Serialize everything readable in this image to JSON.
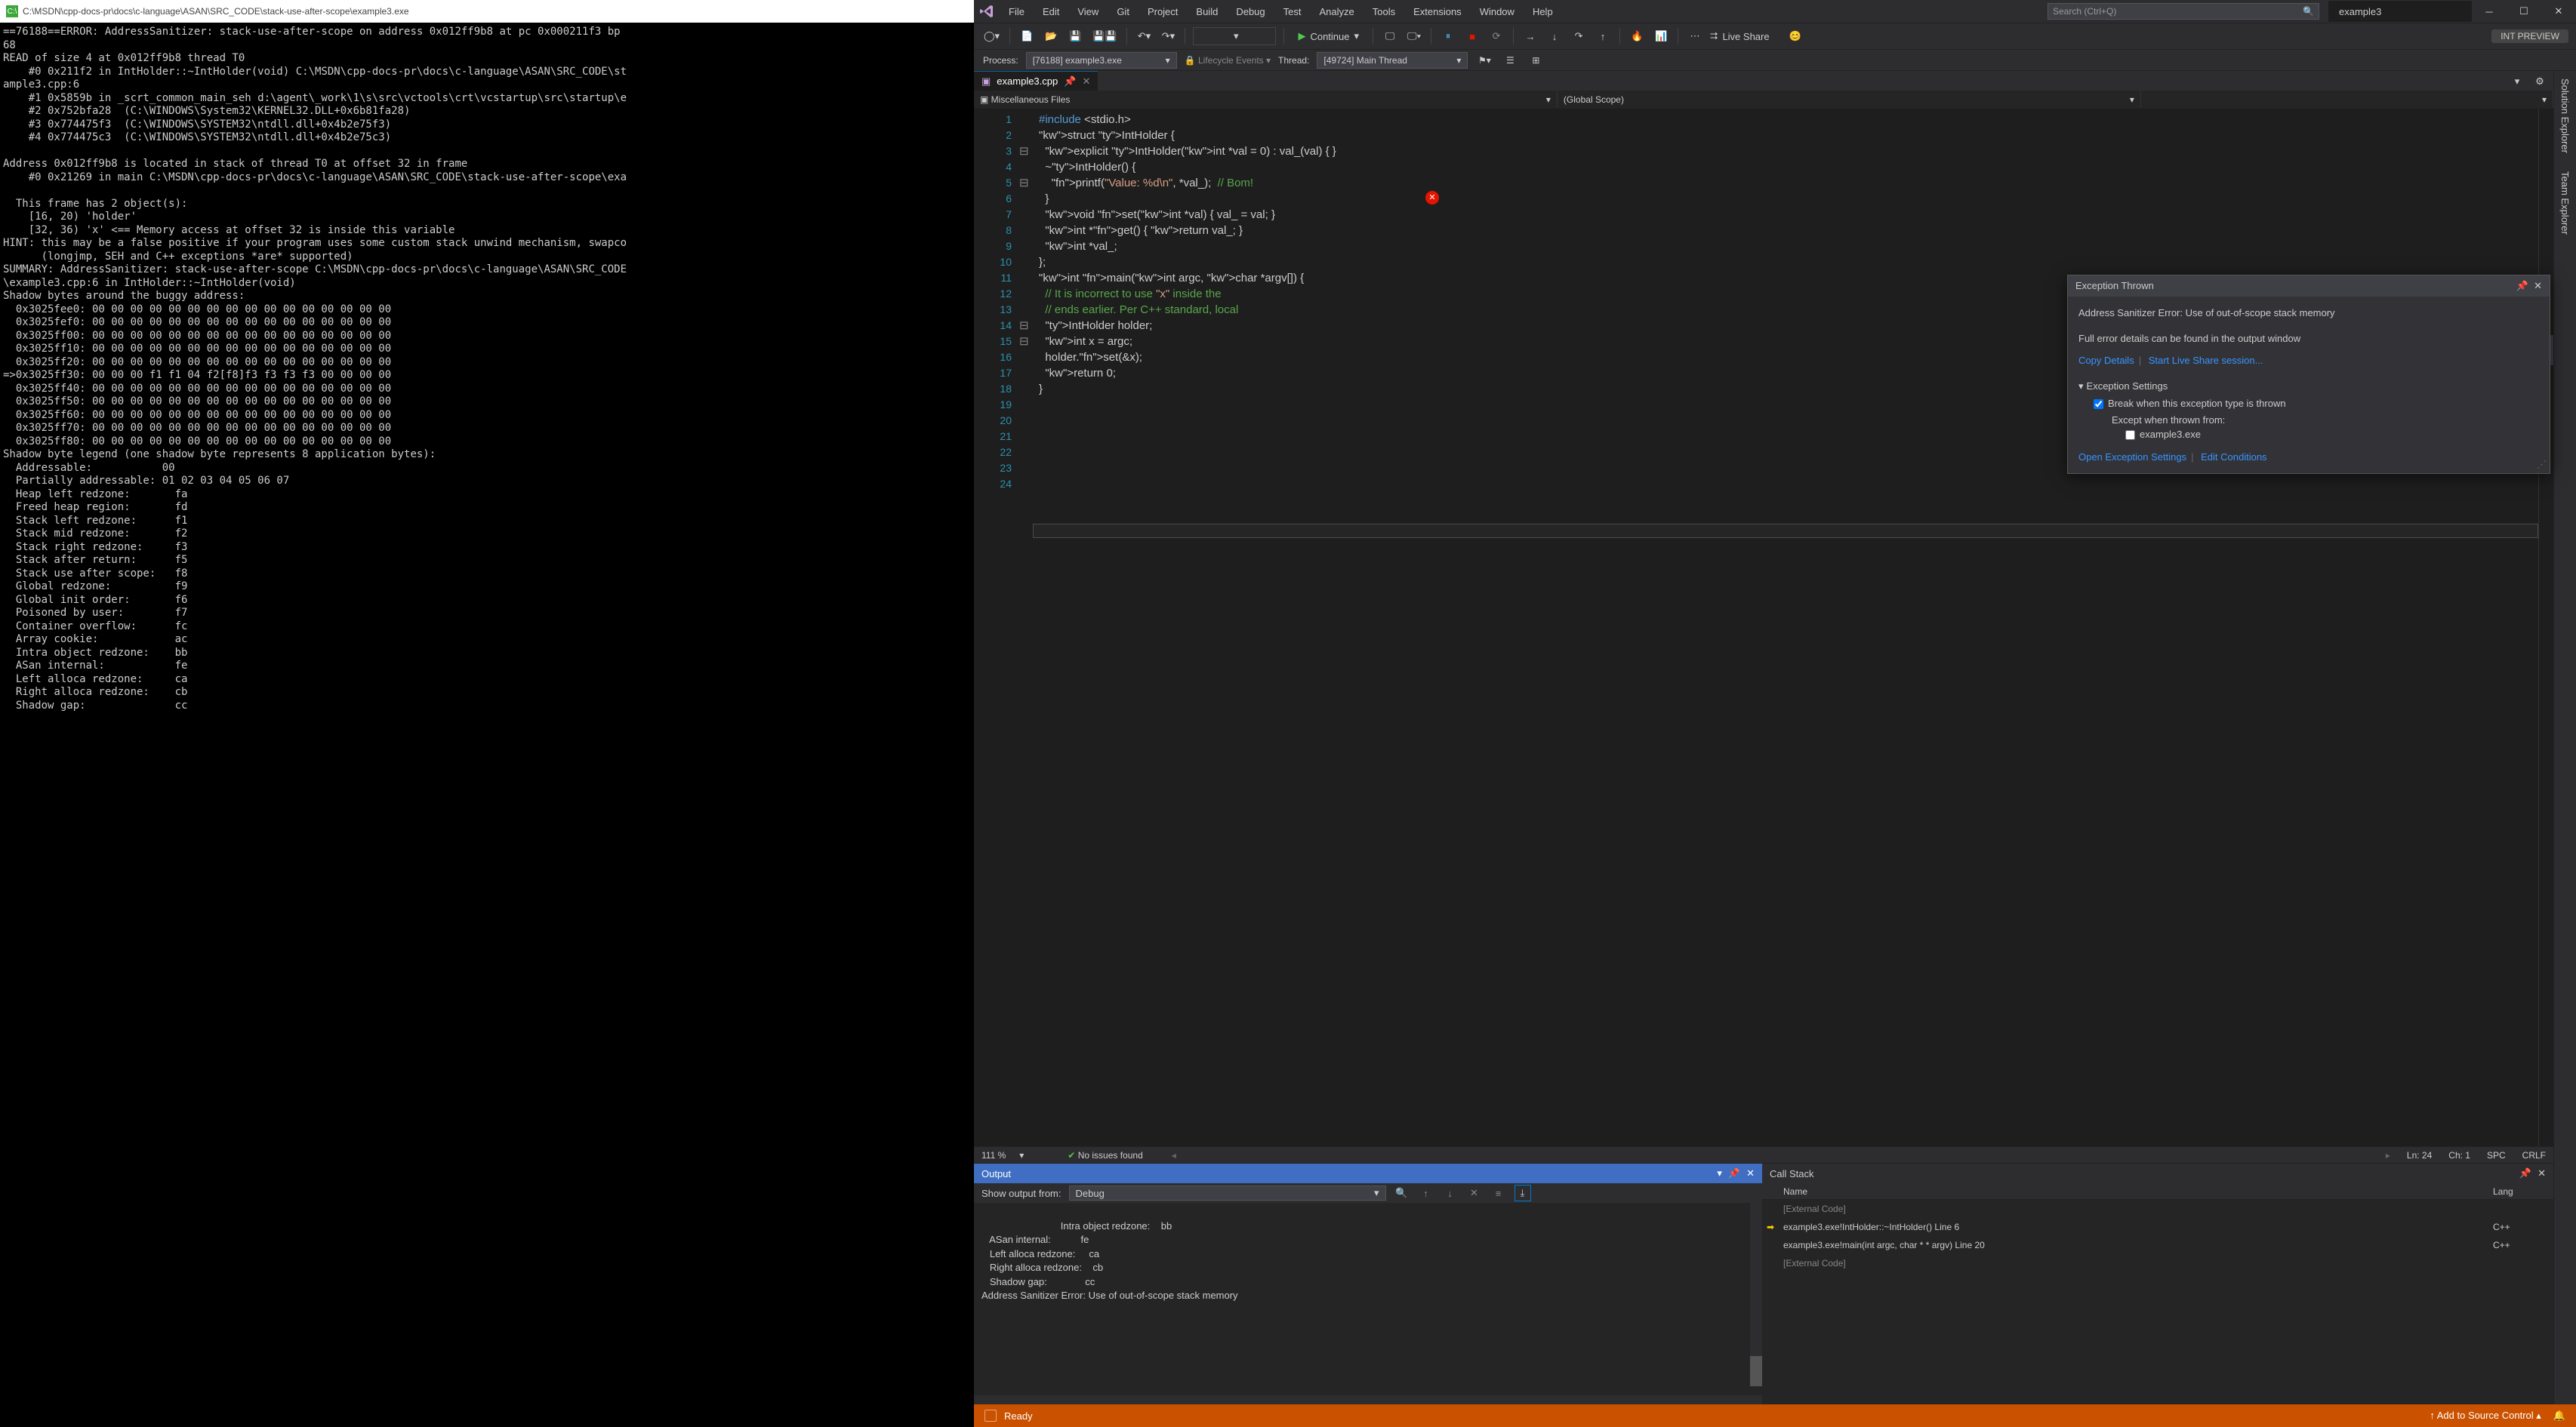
{
  "console": {
    "title": "C:\\MSDN\\cpp-docs-pr\\docs\\c-language\\ASAN\\SRC_CODE\\stack-use-after-scope\\example3.exe",
    "body": "==76188==ERROR: AddressSanitizer: stack-use-after-scope on address 0x012ff9b8 at pc 0x000211f3 bp\n68\nREAD of size 4 at 0x012ff9b8 thread T0\n    #0 0x211f2 in IntHolder::~IntHolder(void) C:\\MSDN\\cpp-docs-pr\\docs\\c-language\\ASAN\\SRC_CODE\\st\nample3.cpp:6\n    #1 0x5859b in _scrt_common_main_seh d:\\agent\\_work\\1\\s\\src\\vctools\\crt\\vcstartup\\src\\startup\\e\n    #2 0x752bfa28  (C:\\WINDOWS\\System32\\KERNEL32.DLL+0x6b81fa28)\n    #3 0x774475f3  (C:\\WINDOWS\\SYSTEM32\\ntdll.dll+0x4b2e75f3)\n    #4 0x774475c3  (C:\\WINDOWS\\SYSTEM32\\ntdll.dll+0x4b2e75c3)\n\nAddress 0x012ff9b8 is located in stack of thread T0 at offset 32 in frame\n    #0 0x21269 in main C:\\MSDN\\cpp-docs-pr\\docs\\c-language\\ASAN\\SRC_CODE\\stack-use-after-scope\\exa\n\n  This frame has 2 object(s):\n    [16, 20) 'holder'\n    [32, 36) 'x' <== Memory access at offset 32 is inside this variable\nHINT: this may be a false positive if your program uses some custom stack unwind mechanism, swapco\n      (longjmp, SEH and C++ exceptions *are* supported)\nSUMMARY: AddressSanitizer: stack-use-after-scope C:\\MSDN\\cpp-docs-pr\\docs\\c-language\\ASAN\\SRC_CODE\n\\example3.cpp:6 in IntHolder::~IntHolder(void)\nShadow bytes around the buggy address:\n  0x3025fee0: 00 00 00 00 00 00 00 00 00 00 00 00 00 00 00 00\n  0x3025fef0: 00 00 00 00 00 00 00 00 00 00 00 00 00 00 00 00\n  0x3025ff00: 00 00 00 00 00 00 00 00 00 00 00 00 00 00 00 00\n  0x3025ff10: 00 00 00 00 00 00 00 00 00 00 00 00 00 00 00 00\n  0x3025ff20: 00 00 00 00 00 00 00 00 00 00 00 00 00 00 00 00\n=>0x3025ff30: 00 00 00 f1 f1 04 f2[f8]f3 f3 f3 f3 00 00 00 00\n  0x3025ff40: 00 00 00 00 00 00 00 00 00 00 00 00 00 00 00 00\n  0x3025ff50: 00 00 00 00 00 00 00 00 00 00 00 00 00 00 00 00\n  0x3025ff60: 00 00 00 00 00 00 00 00 00 00 00 00 00 00 00 00\n  0x3025ff70: 00 00 00 00 00 00 00 00 00 00 00 00 00 00 00 00\n  0x3025ff80: 00 00 00 00 00 00 00 00 00 00 00 00 00 00 00 00\nShadow byte legend (one shadow byte represents 8 application bytes):\n  Addressable:           00\n  Partially addressable: 01 02 03 04 05 06 07\n  Heap left redzone:       fa\n  Freed heap region:       fd\n  Stack left redzone:      f1\n  Stack mid redzone:       f2\n  Stack right redzone:     f3\n  Stack after return:      f5\n  Stack use after scope:   f8\n  Global redzone:          f9\n  Global init order:       f6\n  Poisoned by user:        f7\n  Container overflow:      fc\n  Array cookie:            ac\n  Intra object redzone:    bb\n  ASan internal:           fe\n  Left alloca redzone:     ca\n  Right alloca redzone:    cb\n  Shadow gap:              cc"
  },
  "menus": [
    "File",
    "Edit",
    "View",
    "Git",
    "Project",
    "Build",
    "Debug",
    "Test",
    "Analyze",
    "Tools",
    "Extensions",
    "Window",
    "Help"
  ],
  "search_placeholder": "Search (Ctrl+Q)",
  "solution_tab": "example3",
  "toolbar": {
    "continue": "Continue",
    "live_share": "Live Share",
    "preview": "INT PREVIEW"
  },
  "debugbar": {
    "process_lbl": "Process:",
    "process_val": "[76188] example3.exe",
    "lifecycle": "Lifecycle Events",
    "thread_lbl": "Thread:",
    "thread_val": "[49724] Main Thread"
  },
  "file_tab": "example3.cpp",
  "nav": {
    "left": "Miscellaneous Files",
    "mid": "(Global Scope)",
    "right": ""
  },
  "code_lines": [
    "#include <stdio.h>",
    "",
    "struct IntHolder {",
    "  explicit IntHolder(int *val = 0) : val_(val) { }",
    "  ~IntHolder() {",
    "    printf(\"Value: %d\\n\", *val_);  // Bom!",
    "  }",
    "  void set(int *val) { val_ = val; }",
    "  int *get() { return val_; }",
    "",
    "  int *val_;",
    "};",
    "",
    "int main(int argc, char *argv[]) {",
    "  // It is incorrect to use \"x\" inside the",
    "  // ends earlier. Per C++ standard, local",
    "  IntHolder holder;",
    "  int x = argc;",
    "  holder.set(&x);",
    "  return 0;",
    "}",
    "",
    "",
    ""
  ],
  "exception": {
    "title": "Exception Thrown",
    "msg": "Address Sanitizer Error: Use of out-of-scope stack memory",
    "details_hint": "Full error details can be found in the output window",
    "copy": "Copy Details",
    "live": "Start Live Share session...",
    "settings_hdr": "Exception Settings",
    "break_chk": "Break when this exception type is thrown",
    "except_lbl": "Except when thrown from:",
    "except_item": "example3.exe",
    "open": "Open Exception Settings",
    "edit": "Edit Conditions"
  },
  "editor_status": {
    "zoom": "111 %",
    "issues": "No issues found",
    "line": "Ln: 24",
    "col": "Ch: 1",
    "mode": "SPC",
    "eol": "CRLF"
  },
  "output": {
    "title": "Output",
    "from_lbl": "Show output from:",
    "from_val": "Debug",
    "body": "   Intra object redzone:    bb\n   ASan internal:           fe\n   Left alloca redzone:     ca\n   Right alloca redzone:    cb\n   Shadow gap:              cc\nAddress Sanitizer Error: Use of out-of-scope stack memory"
  },
  "callstack": {
    "title": "Call Stack",
    "col_name": "Name",
    "col_lang": "Lang",
    "rows": [
      {
        "glyph": "",
        "txt": "[External Code]",
        "lang": "",
        "ext": true
      },
      {
        "glyph": "arrow",
        "txt": "example3.exe!IntHolder::~IntHolder() Line 6",
        "lang": "C++",
        "ext": false
      },
      {
        "glyph": "",
        "txt": "example3.exe!main(int argc, char * * argv) Line 20",
        "lang": "C++",
        "ext": false
      },
      {
        "glyph": "",
        "txt": "[External Code]",
        "lang": "",
        "ext": true
      }
    ]
  },
  "tool_tabs": [
    "Solution Explorer",
    "Team Explorer"
  ],
  "statusbar": {
    "ready": "Ready",
    "source": "Add to Source Control"
  }
}
